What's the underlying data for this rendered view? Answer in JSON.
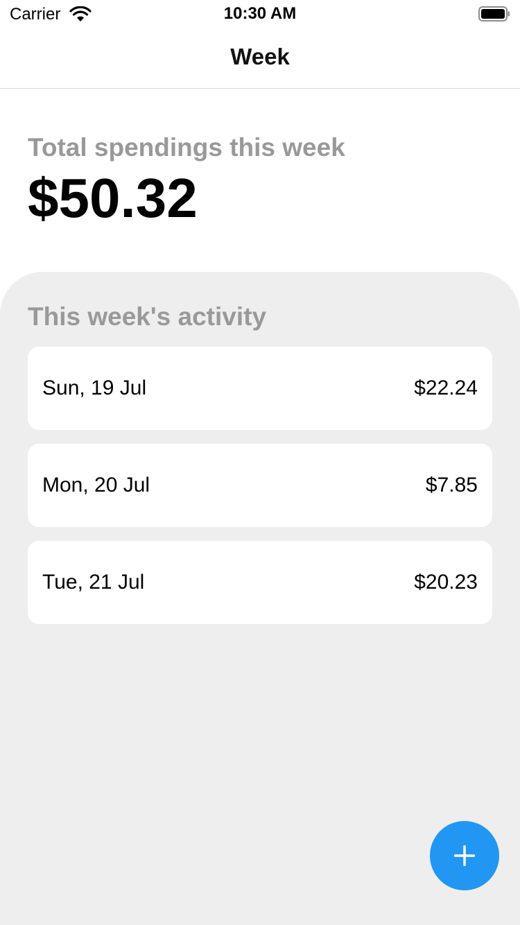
{
  "status_bar": {
    "carrier": "Carrier",
    "time": "10:30 AM",
    "wifi_icon": "wifi-icon",
    "battery_icon": "battery-icon"
  },
  "nav": {
    "title": "Week"
  },
  "summary": {
    "label": "Total spendings this week",
    "amount": "$50.32"
  },
  "activity": {
    "heading": "This week's activity",
    "items": [
      {
        "date": "Sun, 19 Jul",
        "amount": "$22.24"
      },
      {
        "date": "Mon, 20 Jul",
        "amount": "$7.85"
      },
      {
        "date": "Tue, 21 Jul",
        "amount": "$20.23"
      }
    ]
  },
  "add_button": {
    "icon": "plus-icon"
  },
  "colors": {
    "accent": "#2196f3",
    "muted_text": "#999999",
    "panel_background": "#eeeeee",
    "card_background": "#ffffff"
  }
}
